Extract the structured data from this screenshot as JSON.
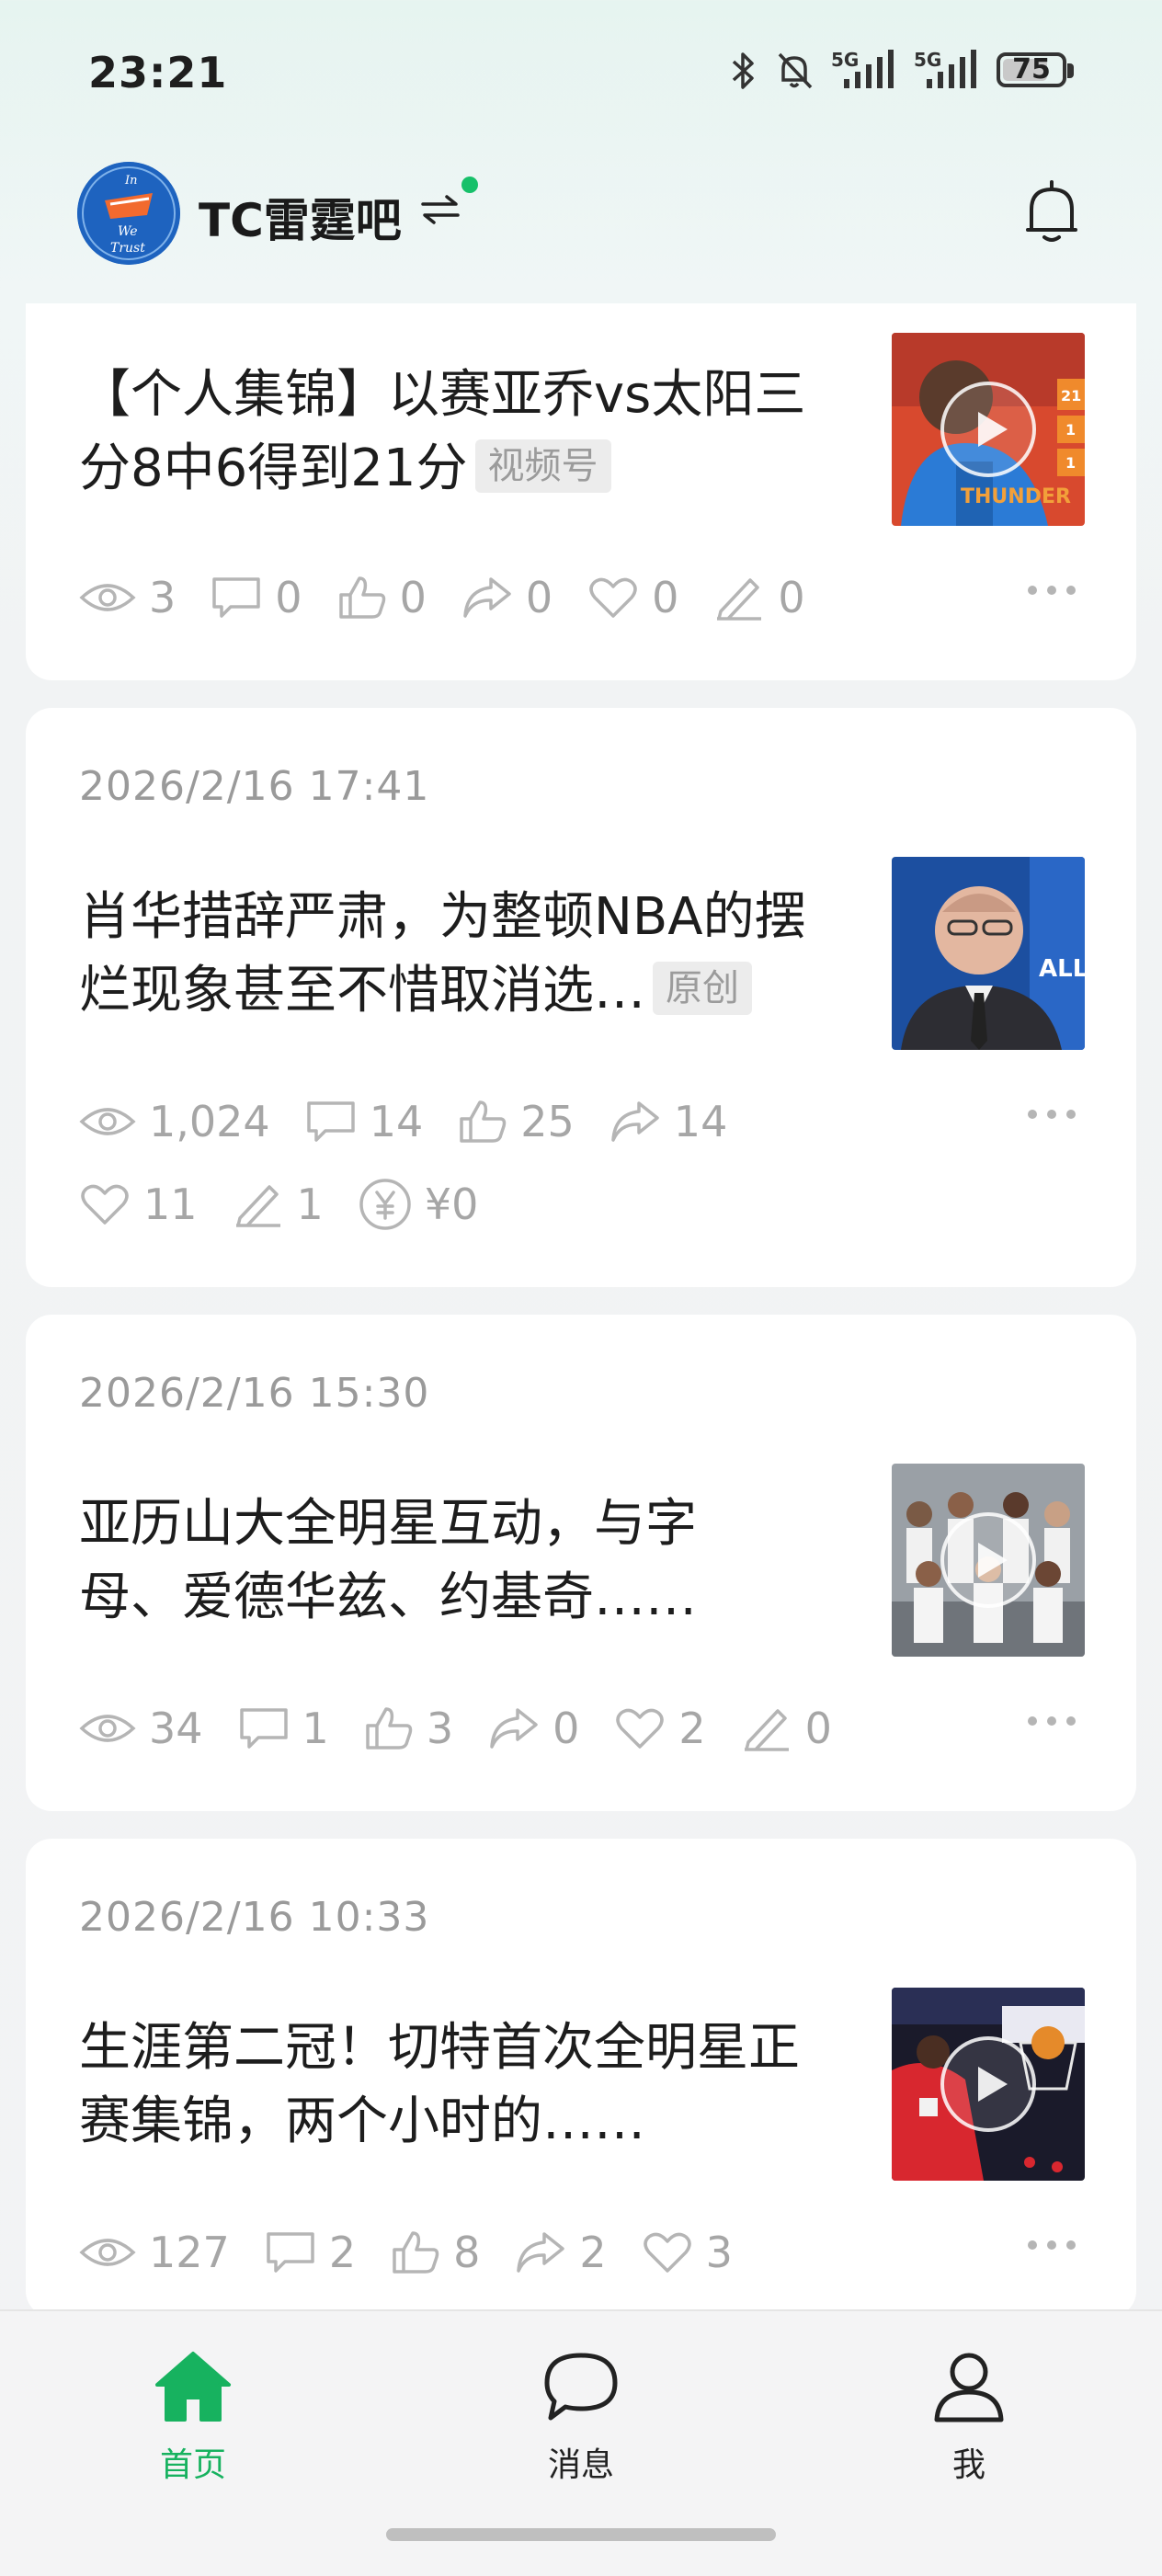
{
  "status_bar": {
    "time": "23:21",
    "battery": "75",
    "battery_level": 0.75,
    "icons": [
      "bluetooth-icon",
      "mute-bell-icon",
      "signal-5g-icon",
      "signal-5g-icon",
      "battery-icon"
    ]
  },
  "header": {
    "group_name": "TC雷霆吧",
    "switch_icon": "⇋",
    "avatar_text": [
      "In",
      "We",
      "Trust"
    ],
    "online_color": "#17c06a"
  },
  "feed": [
    {
      "date": "",
      "title": "【个人集锦】以赛亚乔vs太阳三分8中6得到21分",
      "tag": "视频号",
      "thumb": "video-thunder-player",
      "has_play": true,
      "stats": {
        "views": "3",
        "comments": "0",
        "likes": "0",
        "shares": "0",
        "favorites": "0",
        "edits": "0"
      }
    },
    {
      "date": "2026/2/16 17:41",
      "title": "肖华措辞严肃，为整顿NBA的摆烂现象甚至不惜取消选…",
      "tag": "原创",
      "thumb": "photo-commissioner",
      "has_play": false,
      "stats": {
        "views": "1,024",
        "comments": "14",
        "likes": "25",
        "shares": "14",
        "favorites": "11",
        "edits": "1",
        "reward": "¥0"
      }
    },
    {
      "date": "2026/2/16 15:30",
      "title": "亚历山大全明星互动，与字母、爱德华兹、约基奇……",
      "tag": "",
      "thumb": "video-team-photo",
      "has_play": true,
      "stats": {
        "views": "34",
        "comments": "1",
        "likes": "3",
        "shares": "0",
        "favorites": "2",
        "edits": "0"
      }
    },
    {
      "date": "2026/2/16 10:33",
      "title": "生涯第二冠！切特首次全明星正赛集锦，两个小时的……",
      "tag": "",
      "thumb": "video-dunk",
      "has_play": true,
      "stats": {
        "views": "127",
        "comments": "2",
        "likes": "8",
        "shares": "2",
        "favorites": "3"
      }
    }
  ],
  "more_icon": "···",
  "bottom_nav": {
    "items": [
      {
        "label": "首页",
        "icon": "home-icon",
        "active": true
      },
      {
        "label": "消息",
        "icon": "message-icon",
        "active": false
      },
      {
        "label": "我",
        "icon": "profile-icon",
        "active": false
      }
    ],
    "active_color": "#17b25f"
  }
}
